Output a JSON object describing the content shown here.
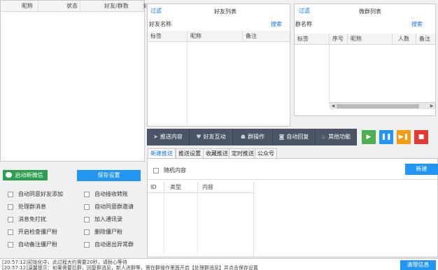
{
  "friend_table": {
    "columns": [
      "昵称",
      "状态",
      "好友/群数",
      "好"
    ]
  },
  "friend_list": {
    "filter": "过滤",
    "title": "好友列表",
    "field_label": "好友名称",
    "search": "搜索",
    "columns": [
      "标签",
      "昵称",
      "备注"
    ]
  },
  "group_list": {
    "filter": "过滤",
    "title": "微群列表",
    "field_label": "群名称",
    "search": "搜索",
    "columns": [
      "标签",
      "序号",
      "昵称",
      "人数",
      "备注"
    ]
  },
  "func_buttons": [
    "推送内容",
    "好友互动",
    "群操作",
    "自动回复",
    "其他功能"
  ],
  "control_buttons": [
    {
      "name": "play",
      "glyph": "▶",
      "color": "#4caf50"
    },
    {
      "name": "pause",
      "glyph": "❚❚",
      "color": "#2196f3"
    },
    {
      "name": "step",
      "glyph": "▶❚",
      "color": "#f39c12"
    },
    {
      "name": "stop",
      "glyph": "■",
      "color": "#e53935"
    }
  ],
  "tabs": [
    "新建推送",
    "推送设置",
    "收藏推送",
    "定时推送",
    "公众号"
  ],
  "push": {
    "random_label": "随机内容",
    "new_button": "新建",
    "columns": [
      "ID",
      "类型",
      "内容"
    ]
  },
  "left": {
    "start_button": "启动新微信",
    "save_button": "保存设置",
    "options": [
      [
        "自动同意好友添加",
        "自动接收转账"
      ],
      [
        "处理群消息",
        "自动同意群邀请"
      ],
      [
        "消息免打扰",
        "加入通讯录"
      ],
      [
        "开启检查僵尸粉",
        "删除僵尸粉"
      ],
      [
        "自动备注僵尸粉",
        "自动退出异常群"
      ]
    ]
  },
  "log": {
    "lines": [
      "[20:57:12]初始化中，此过程大约需要20秒，请耐心等待",
      "[20:57:12]温馨提示：如果需要拉群，回复群消息，新人进群等，需在群操作里面开启【处理群消息】并点击保存设置"
    ],
    "clear_button": "清理信息"
  },
  "colors": {
    "accent": "#2196f3",
    "func_bg": "#4a5565",
    "start_green": "#2e9e4f"
  }
}
